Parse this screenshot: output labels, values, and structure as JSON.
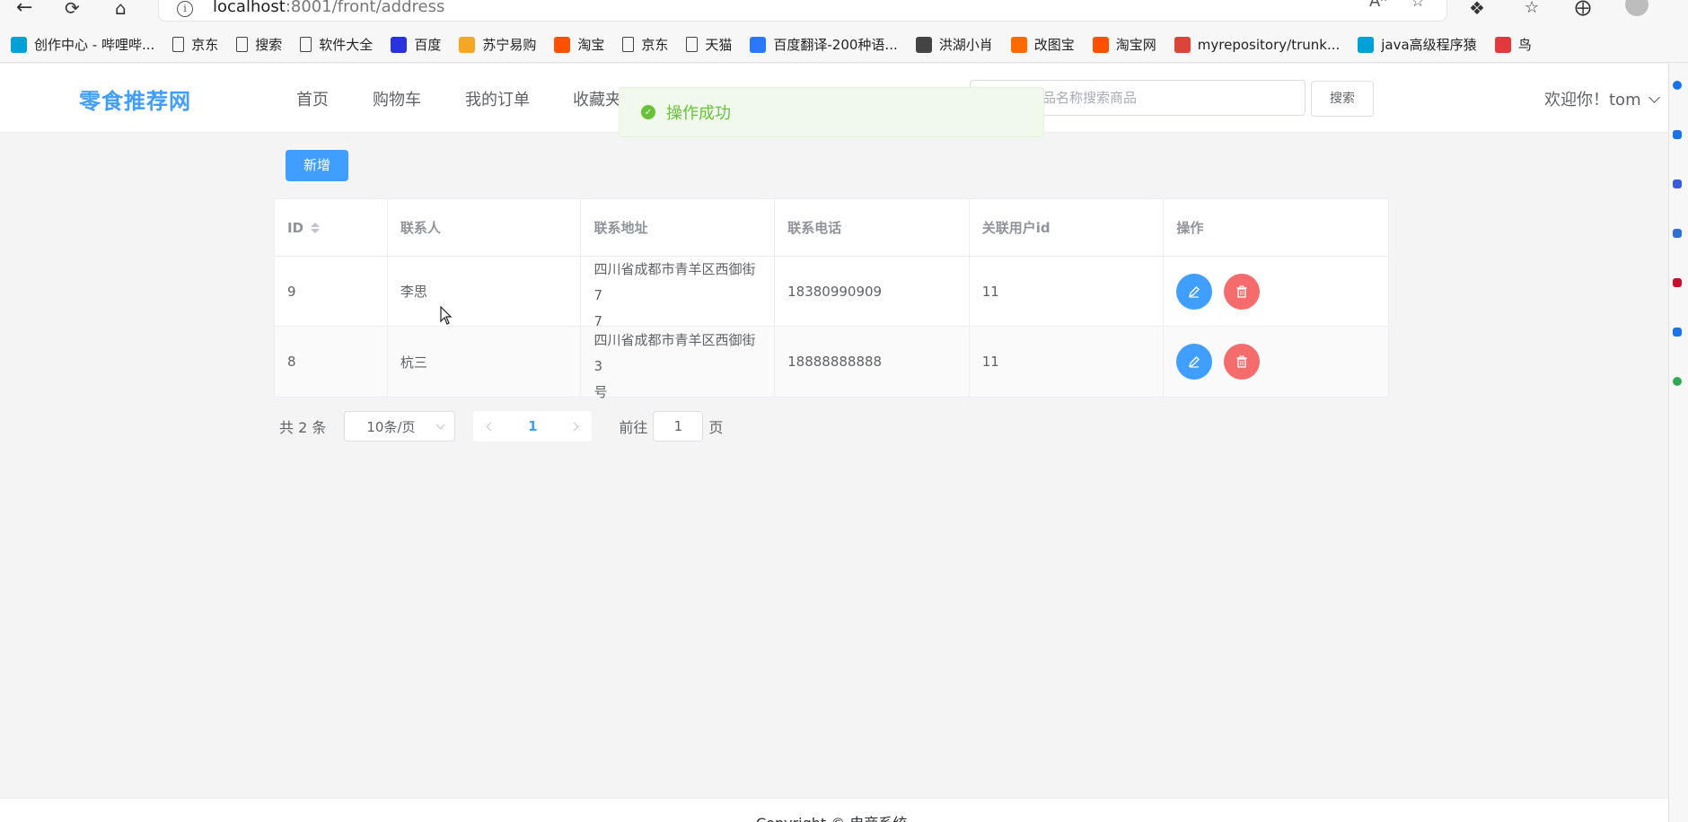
{
  "browser": {
    "url_host": "localhost",
    "url_rest": ":8001/front/address",
    "bookmarks": [
      {
        "label": "创作中心 - 哔哩哔...",
        "icon": "bilibili-icon",
        "color": "#00a1d6"
      },
      {
        "label": "京东",
        "icon": "page-icon",
        "color": ""
      },
      {
        "label": "搜索",
        "icon": "page-icon",
        "color": ""
      },
      {
        "label": "软件大全",
        "icon": "page-icon",
        "color": ""
      },
      {
        "label": "百度",
        "icon": "baidu-paw-icon",
        "color": "#2932e1"
      },
      {
        "label": "苏宁易购",
        "icon": "suning-icon",
        "color": "#f5a623"
      },
      {
        "label": "淘宝",
        "icon": "taobao-icon",
        "color": "#ff5000"
      },
      {
        "label": "京东",
        "icon": "page-icon",
        "color": ""
      },
      {
        "label": "天猫",
        "icon": "page-icon",
        "color": ""
      },
      {
        "label": "百度翻译-200种语...",
        "icon": "translate-icon",
        "color": "#2b77ff"
      },
      {
        "label": "洪湖小肖",
        "icon": "bird-icon",
        "color": "#444444"
      },
      {
        "label": "改图宝",
        "icon": "image-icon",
        "color": "#ff6a00"
      },
      {
        "label": "淘宝网",
        "icon": "taobao-icon",
        "color": "#ff5000"
      },
      {
        "label": "myrepository/trunk...",
        "icon": "chrome-icon",
        "color": "#db4437"
      },
      {
        "label": "java高级程序猿",
        "icon": "bilibili-icon",
        "color": "#00a1d6"
      },
      {
        "label": "鸟",
        "icon": "bird-icon",
        "color": "#e4393c"
      }
    ]
  },
  "header": {
    "logo": "零食推荐网",
    "nav": [
      "首页",
      "购物车",
      "我的订单",
      "收藏夹"
    ],
    "search_placeholder": "请输入商品名称搜索商品",
    "search_visible_placeholder": "品名称搜索商品",
    "search_button": "搜索",
    "welcome": "欢迎你！tom"
  },
  "toast": {
    "text": "操作成功",
    "color": "#67c23a"
  },
  "toolbar": {
    "add_label": "新增"
  },
  "table": {
    "columns": [
      "ID",
      "联系人",
      "联系地址",
      "联系电话",
      "关联用户id",
      "操作"
    ],
    "rows": [
      {
        "id": "9",
        "name": "李思",
        "address_line1": "四川省成都市青羊区西御街7",
        "address_line2": "7",
        "phone": "18380990909",
        "user_id": "11"
      },
      {
        "id": "8",
        "name": "杭三",
        "address_line1": "四川省成都市青羊区西御街3",
        "address_line2": "号",
        "phone": "18888888888",
        "user_id": "11"
      }
    ]
  },
  "pagination": {
    "total_text": "共 2 条",
    "page_size": "10条/页",
    "current_page": "1",
    "goto_prefix": "前往",
    "goto_value": "1",
    "goto_suffix": "页"
  },
  "footer": {
    "text": "Copyright © 电商系统"
  },
  "colors": {
    "primary": "#409eff",
    "danger": "#f56c6c",
    "success": "#67c23a"
  }
}
